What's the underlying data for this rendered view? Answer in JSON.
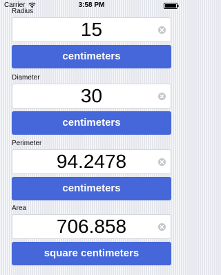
{
  "status_bar": {
    "carrier": "Carrier",
    "time": "3:58 PM",
    "wifi_icon": "wifi-icon",
    "battery_icon": "battery-icon"
  },
  "fields": [
    {
      "label": "Radius",
      "value": "15",
      "unit": "centimeters"
    },
    {
      "label": "Diameter",
      "value": "30",
      "unit": "centimeters"
    },
    {
      "label": "Perimeter",
      "value": "94.2478",
      "unit": "centimeters"
    },
    {
      "label": "Area",
      "value": "706.858",
      "unit": "square centimeters"
    }
  ],
  "colors": {
    "button_blue": "#4567d9",
    "background": "#eeeff4",
    "clear_icon": "#c6c7cc"
  },
  "icons": {
    "clear": "clear-icon"
  }
}
